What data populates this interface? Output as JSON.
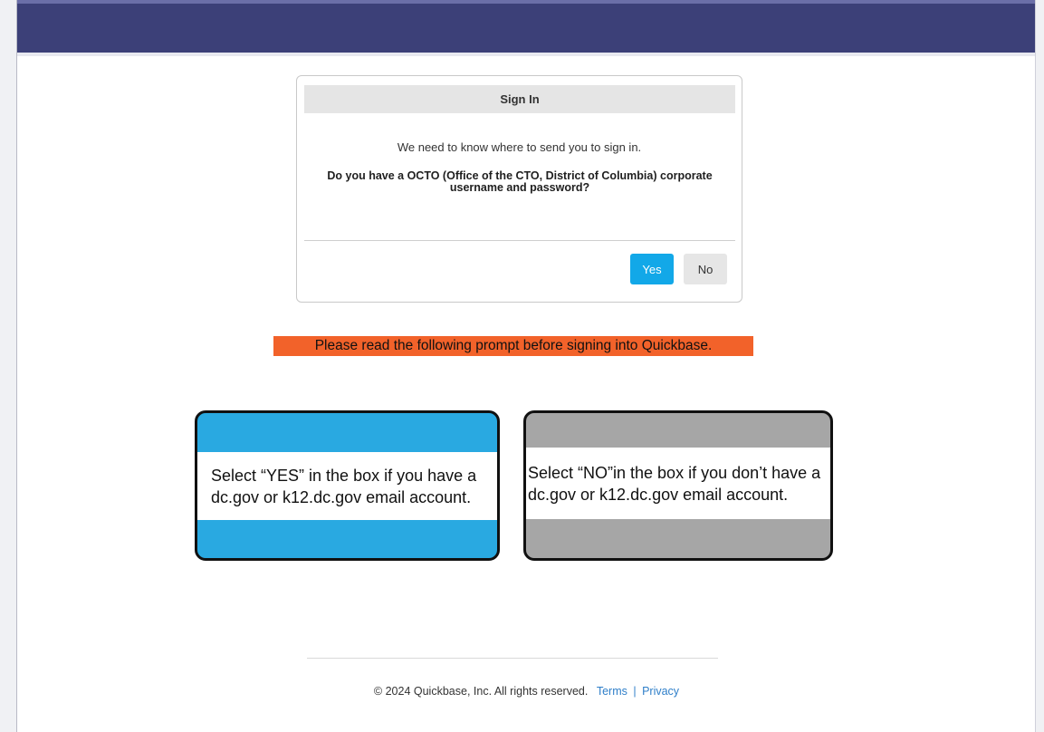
{
  "signin": {
    "title": "Sign In",
    "message": "We need to know where to send you to sign in.",
    "question": "Do you have a OCTO (Office of the CTO, District of Columbia) corporate username and password?",
    "yes_label": "Yes",
    "no_label": "No"
  },
  "notice": {
    "text": "Please read the following prompt before signing into Quickbase."
  },
  "instructions": {
    "yes_box": "Select “YES” in the box if you have a dc.gov or k12.dc.gov email account.",
    "no_box": "Select “NO”in the box if you don’t have a dc.gov or k12.dc.gov email account."
  },
  "footer": {
    "copyright": "© 2024 Quickbase, Inc. All rights reserved.",
    "terms_label": "Terms",
    "separator": "|",
    "privacy_label": "Privacy"
  },
  "colors": {
    "banner": "#3c4078",
    "primary_button": "#12a8e8",
    "notice_background": "#f2622a",
    "yes_box": "#29a9e1",
    "no_box": "#a6a6a6"
  }
}
